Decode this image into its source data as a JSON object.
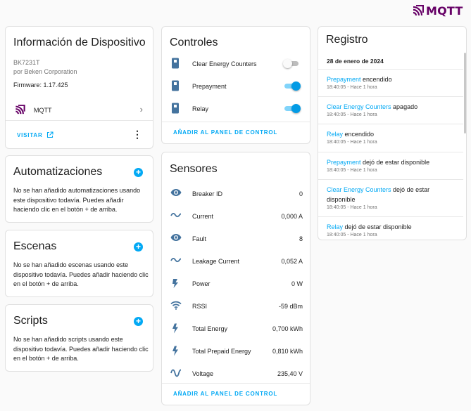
{
  "brand": {
    "logo_text": "MQTT",
    "color": "#660066"
  },
  "device": {
    "title": "Información de Dispositivo",
    "model": "BK7231T",
    "manufacturer": "por Beken Corporation",
    "firmware": "Firmware: 1.17.425",
    "integration_label": "MQTT",
    "visit_label": "VISITAR"
  },
  "automations": {
    "title": "Automatizaciones",
    "description": "No se han añadido automatizaciones usando este dispositivo todavía. Puedes añadir haciendo clic en el botón + de arriba."
  },
  "scenes": {
    "title": "Escenas",
    "description": "No se han añadido escenas usando este dispositivo todavía. Puedes añadir haciendo clic en el botón + de arriba."
  },
  "scripts": {
    "title": "Scripts",
    "description": "No se han añadido scripts usando este dispositivo todavía. Puedes añadir haciendo clic en el botón + de arriba."
  },
  "controls": {
    "title": "Controles",
    "items": [
      {
        "name": "Clear Energy Counters",
        "state": "off",
        "icon": "switch-icon"
      },
      {
        "name": "Prepayment",
        "state": "on",
        "icon": "switch-icon"
      },
      {
        "name": "Relay",
        "state": "on",
        "icon": "switch-icon"
      }
    ],
    "add_label": "AÑADIR AL PANEL DE CONTROL"
  },
  "sensors": {
    "title": "Sensores",
    "items": [
      {
        "name": "Breaker ID",
        "value": "0",
        "icon": "eye-icon"
      },
      {
        "name": "Current",
        "value": "0,000 A",
        "icon": "current-ac-icon"
      },
      {
        "name": "Fault",
        "value": "8",
        "icon": "eye-icon"
      },
      {
        "name": "Leakage Current",
        "value": "0,052 A",
        "icon": "current-ac-icon"
      },
      {
        "name": "Power",
        "value": "0 W",
        "icon": "flash-icon"
      },
      {
        "name": "RSSI",
        "value": "-59 dBm",
        "icon": "wifi-icon"
      },
      {
        "name": "Total Energy",
        "value": "0,700 kWh",
        "icon": "lightning-icon"
      },
      {
        "name": "Total Prepaid Energy",
        "value": "0,810 kWh",
        "icon": "lightning-icon"
      },
      {
        "name": "Voltage",
        "value": "235,40 V",
        "icon": "sine-wave-icon"
      }
    ],
    "add_label": "AÑADIR AL PANEL DE CONTROL"
  },
  "logbook": {
    "title": "Registro",
    "date": "28 de enero de 2024",
    "entries": [
      {
        "entity": "Prepayment",
        "action": " encendido",
        "time": "18:40:05 - Hace 1 hora"
      },
      {
        "entity": "Clear Energy Counters",
        "action": " apagado",
        "time": "18:40:05 - Hace 1 hora"
      },
      {
        "entity": "Relay",
        "action": " encendido",
        "time": "18:40:05 - Hace 1 hora"
      },
      {
        "entity": "Prepayment",
        "action": " dejó de estar disponible",
        "time": "18:40:05 - Hace 1 hora"
      },
      {
        "entity": "Clear Energy Counters",
        "action": " dejó de estar disponible",
        "time": "18:40:05 - Hace 1 hora"
      },
      {
        "entity": "Relay",
        "action": " dejó de estar disponible",
        "time": "18:40:05 - Hace 1 hora"
      }
    ]
  },
  "colors": {
    "accent": "#03a9f4",
    "toggle_on": "#039be5",
    "icon": "#44739e"
  }
}
